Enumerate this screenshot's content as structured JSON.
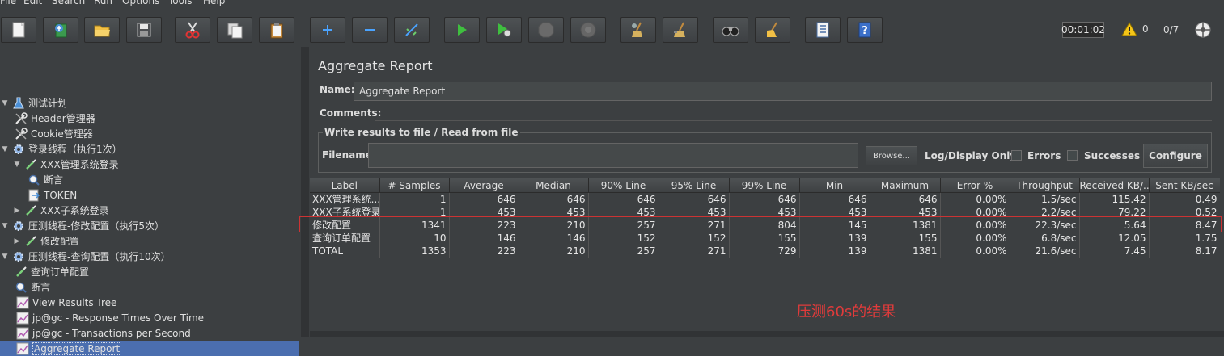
{
  "menu": [
    "File",
    "Edit",
    "Search",
    "Run",
    "Options",
    "Tools",
    "Help"
  ],
  "toolbar": {
    "buttons": [
      {
        "name": "new-plan-button",
        "icon": "new-doc-icon"
      },
      {
        "name": "templates-button",
        "icon": "templates-icon"
      },
      {
        "name": "open-button",
        "icon": "folder-open-icon"
      },
      {
        "name": "save-button",
        "icon": "save-icon"
      },
      {
        "name": "cut-button",
        "icon": "scissors-icon"
      },
      {
        "name": "copy-button",
        "icon": "copy-icon"
      },
      {
        "name": "paste-button",
        "icon": "paste-icon"
      },
      {
        "name": "expand-button",
        "icon": "plus-icon"
      },
      {
        "name": "collapse-button",
        "icon": "minus-icon"
      },
      {
        "name": "toggle-button",
        "icon": "wand-icon"
      },
      {
        "name": "start-button",
        "icon": "play-icon"
      },
      {
        "name": "start-no-pause-button",
        "icon": "play-timer-icon"
      },
      {
        "name": "stop-button",
        "icon": "stop-icon"
      },
      {
        "name": "shutdown-button",
        "icon": "shutdown-icon"
      },
      {
        "name": "clear-button",
        "icon": "broom-gear-icon"
      },
      {
        "name": "clear-all-button",
        "icon": "broom-all-icon"
      },
      {
        "name": "search-button",
        "icon": "binoculars-icon"
      },
      {
        "name": "reset-search-button",
        "icon": "broom-icon"
      },
      {
        "name": "function-helper-button",
        "icon": "list-icon"
      },
      {
        "name": "help-button",
        "icon": "help-book-icon"
      }
    ],
    "timer": "00:01:02",
    "warnings": "0",
    "threads": "0/7"
  },
  "tree": [
    {
      "label": "测试计划",
      "level": 0,
      "toggle": "▼",
      "icon": "flask-icon"
    },
    {
      "label": "Header管理器",
      "level": 1,
      "toggle": "",
      "icon": "wrench-icon"
    },
    {
      "label": "Cookie管理器",
      "level": 1,
      "toggle": "",
      "icon": "wrench-icon"
    },
    {
      "label": "登录线程（执行1次）",
      "level": 0,
      "toggle": "▼",
      "icon": "gear-icon"
    },
    {
      "label": "XXX管理系统登录",
      "level": 1,
      "toggle": "▼",
      "icon": "pipette-icon"
    },
    {
      "label": "断言",
      "level": 2,
      "toggle": "",
      "icon": "magnifier-icon"
    },
    {
      "label": "TOKEN",
      "level": 2,
      "toggle": "",
      "icon": "extractor-icon"
    },
    {
      "label": "XXX子系统登录",
      "level": 1,
      "toggle": "▶",
      "icon": "pipette-icon"
    },
    {
      "label": "压测线程-修改配置（执行5次）",
      "level": 0,
      "toggle": "▼",
      "icon": "gear-icon"
    },
    {
      "label": "修改配置",
      "level": 1,
      "toggle": "▶",
      "icon": "pipette-icon"
    },
    {
      "label": "压测线程-查询配置（执行10次）",
      "level": 0,
      "toggle": "▼",
      "icon": "gear-icon"
    },
    {
      "label": "查询订单配置",
      "level": 1,
      "toggle": "",
      "icon": "pipette-icon"
    },
    {
      "label": "断言",
      "level": 1,
      "toggle": "",
      "icon": "magnifier-icon"
    },
    {
      "label": "View Results Tree",
      "level": 1,
      "toggle": "",
      "icon": "chart-icon"
    },
    {
      "label": "jp@gc - Response Times Over Time",
      "level": 1,
      "toggle": "",
      "icon": "chart-icon"
    },
    {
      "label": "jp@gc - Transactions per Second",
      "level": 1,
      "toggle": "",
      "icon": "chart-icon"
    },
    {
      "label": "Aggregate Report",
      "level": 1,
      "toggle": "",
      "icon": "chart-icon",
      "selected": true
    }
  ],
  "report": {
    "title": "Aggregate Report",
    "name_label": "Name:",
    "name_value": "Aggregate Report",
    "comments_label": "Comments:",
    "write_results_legend": "Write results to file / Read from file",
    "filename_label": "Filename",
    "filename_value": "",
    "browse_label": "Browse...",
    "log_only_label": "Log/Display Only:",
    "errors_label": "Errors",
    "successes_label": "Successes",
    "configure_label": "Configure"
  },
  "table": {
    "columns": [
      "Label",
      "# Samples",
      "Average",
      "Median",
      "90% Line",
      "95% Line",
      "99% Line",
      "Min",
      "Maximum",
      "Error %",
      "Throughput",
      "Received KB/...",
      "Sent KB/sec"
    ],
    "rows": [
      [
        "XXX管理系统...",
        "1",
        "646",
        "646",
        "646",
        "646",
        "646",
        "646",
        "646",
        "0.00%",
        "1.5/sec",
        "115.42",
        "0.49"
      ],
      [
        "XXX子系统登录",
        "1",
        "453",
        "453",
        "453",
        "453",
        "453",
        "453",
        "453",
        "0.00%",
        "2.2/sec",
        "79.22",
        "0.52"
      ],
      [
        "修改配置",
        "1341",
        "223",
        "210",
        "257",
        "271",
        "804",
        "145",
        "1381",
        "0.00%",
        "22.3/sec",
        "5.64",
        "8.47"
      ],
      [
        "查询订单配置",
        "10",
        "146",
        "146",
        "152",
        "152",
        "155",
        "139",
        "155",
        "0.00%",
        "6.8/sec",
        "12.05",
        "1.75"
      ],
      [
        "TOTAL",
        "1353",
        "223",
        "210",
        "257",
        "271",
        "729",
        "139",
        "1381",
        "0.00%",
        "21.6/sec",
        "7.45",
        "8.17"
      ]
    ]
  },
  "annotation": "压测60s的结果",
  "colors": {
    "background": "#3c3f41",
    "selection": "#4b6eaf",
    "annotation": "#e03b3b",
    "highlight_border": "#cc3333"
  }
}
